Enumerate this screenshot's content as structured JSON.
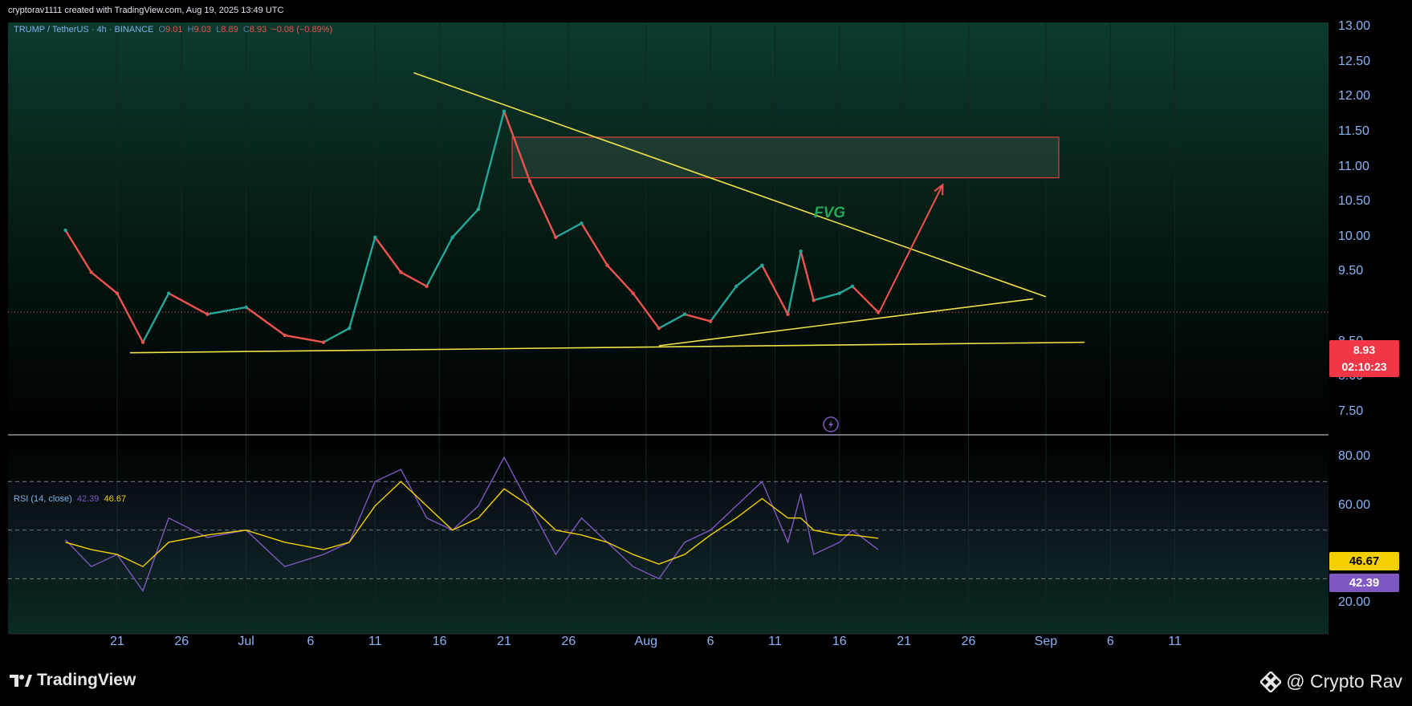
{
  "header": {
    "credit": "cryptorav1111 created with TradingView.com, Aug 19, 2025 13:49 UTC"
  },
  "legend": {
    "symbol": "TRUMP / TetherUS · 4h · BINANCE",
    "open_label": "O",
    "open": "9.01",
    "high_label": "H",
    "high": "9.03",
    "low_label": "L",
    "low": "8.89",
    "close_label": "C",
    "close": "8.93",
    "change": "−0.08 (−0.89%)"
  },
  "rsi_legend": {
    "name": "RSI (14, close)",
    "rsi_value": "42.39",
    "ma_value": "46.67"
  },
  "price_tag": {
    "price": "8.93",
    "countdown": "02:10:23"
  },
  "rsi_tags": {
    "ma": "46.67",
    "rsi": "42.39"
  },
  "annotation": {
    "fvg_label": "FVG"
  },
  "price_axis": [
    "13.00",
    "12.50",
    "12.00",
    "11.50",
    "11.00",
    "10.50",
    "10.00",
    "9.50",
    "8.50",
    "8.00",
    "7.50"
  ],
  "rsi_axis": [
    "80.00",
    "60.00",
    "20.00"
  ],
  "time_axis": [
    "21",
    "26",
    "Jul",
    "6",
    "11",
    "16",
    "21",
    "26",
    "Aug",
    "6",
    "11",
    "16",
    "21",
    "26",
    "Sep",
    "6",
    "11"
  ],
  "footer": {
    "logo_text": "TradingView",
    "brand": "@ Crypto Rav"
  },
  "colors": {
    "up": "#26a69a",
    "down": "#ef5350",
    "trendline": "#f2e24a",
    "rsi": "#7e57c2",
    "rsi_ma": "#f5d000",
    "axis_text": "#8ab4f8"
  },
  "chart_data": {
    "type": "line",
    "title": "TRUMP / TetherUS · 4h · BINANCE",
    "x": [
      "Jun 17",
      "Jun 19",
      "Jun 21",
      "Jun 23",
      "Jun 25",
      "Jun 28",
      "Jul 1",
      "Jul 4",
      "Jul 7",
      "Jul 9",
      "Jul 11",
      "Jul 13",
      "Jul 15",
      "Jul 17",
      "Jul 19",
      "Jul 21",
      "Jul 23",
      "Jul 25",
      "Jul 27",
      "Jul 29",
      "Jul 31",
      "Aug 2",
      "Aug 4",
      "Aug 6",
      "Aug 8",
      "Aug 10",
      "Aug 12",
      "Aug 13",
      "Aug 14",
      "Aug 16",
      "Aug 17",
      "Aug 19"
    ],
    "series": [
      {
        "values": [
          10.1,
          9.5,
          9.2,
          8.5,
          9.2,
          8.9,
          9.0,
          8.6,
          8.5,
          8.7,
          10.0,
          9.5,
          9.3,
          10.0,
          10.4,
          11.8,
          10.8,
          10.0,
          10.2,
          9.6,
          9.2,
          8.7,
          8.9,
          8.8,
          9.3,
          9.6,
          8.9,
          9.8,
          9.1,
          9.2,
          9.3,
          8.93
        ]
      },
      {
        "values": [
          46,
          35,
          40,
          25,
          55,
          47,
          50,
          35,
          40,
          45,
          70,
          75,
          55,
          50,
          60,
          80,
          60,
          40,
          55,
          45,
          35,
          30,
          45,
          50,
          60,
          70,
          45,
          65,
          40,
          45,
          50,
          42
        ]
      },
      {
        "values": [
          45,
          42,
          40,
          35,
          45,
          48,
          50,
          45,
          42,
          45,
          60,
          70,
          60,
          50,
          55,
          67,
          60,
          50,
          48,
          45,
          40,
          36,
          40,
          48,
          55,
          63,
          55,
          55,
          50,
          48,
          48,
          46.67
        ]
      }
    ],
    "price_ylim": [
      7.3,
      13.0
    ],
    "rsi_ylim": [
      20,
      90
    ],
    "price_levels": {
      "last_price": 8.93
    },
    "fvg_zone": {
      "low": 10.85,
      "high": 11.43,
      "from": "Jul 21",
      "to": "Sep 2"
    },
    "trendlines": [
      {
        "from": {
          "x": "Jul 14",
          "y": 12.35
        },
        "to": {
          "x": "Sep 1",
          "y": 9.15
        }
      },
      {
        "from": {
          "x": "Jun 22",
          "y": 8.35
        },
        "to": {
          "x": "Sep 4",
          "y": 8.5
        }
      },
      {
        "from": {
          "x": "Aug 2",
          "y": 8.45
        },
        "to": {
          "x": "Aug 31",
          "y": 9.12
        }
      }
    ],
    "projection_arrow": {
      "from": {
        "x": "Aug 19",
        "y": 8.9
      },
      "to": {
        "x": "Aug 24",
        "y": 10.75
      }
    },
    "rsi_levels": [
      70,
      50,
      30
    ]
  }
}
